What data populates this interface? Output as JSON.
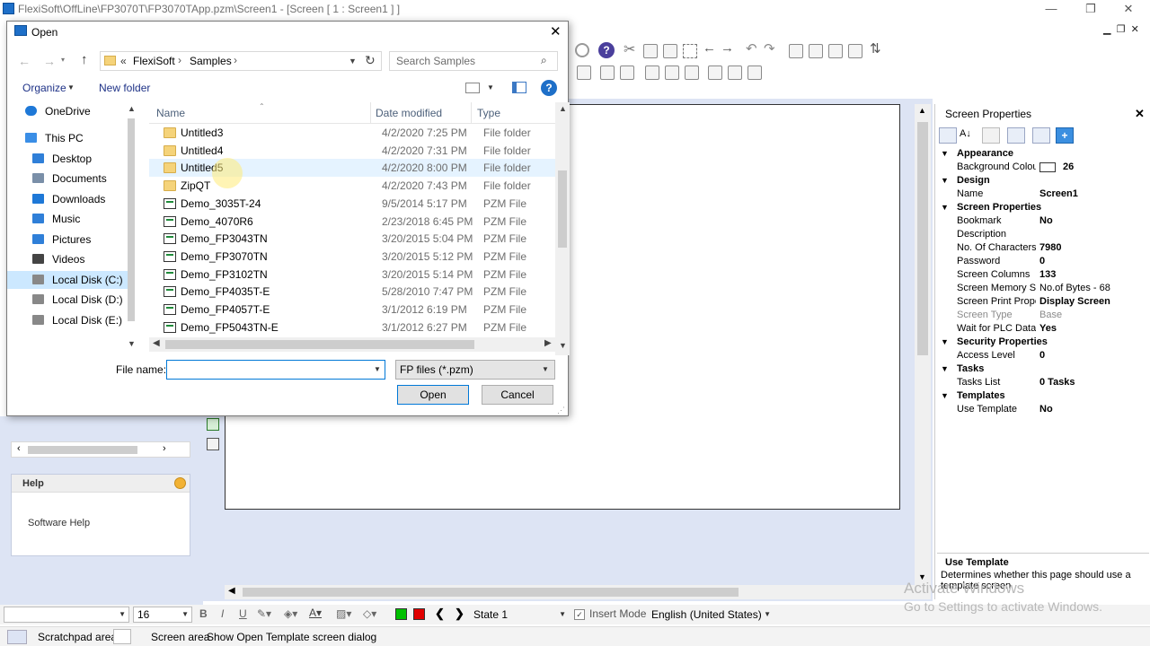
{
  "app": {
    "title": "FlexiSoft\\OffLine\\FP3070T\\FP3070TApp.pzm\\Screen1 - [Screen  [ 1 :  Screen1 ] ]",
    "minimize": "—",
    "restore": "❐",
    "close": "✕"
  },
  "dialog": {
    "title": "Open",
    "close": "✕",
    "address": {
      "prefix": "«",
      "parts": [
        "FlexiSoft",
        "Samples"
      ]
    },
    "search_placeholder": "Search Samples",
    "organize_label": "Organize",
    "new_folder_label": "New folder",
    "nav_items": [
      {
        "label": "OneDrive",
        "icon": "cloud-icon"
      },
      {
        "label": "This PC",
        "icon": "computer-icon"
      },
      {
        "label": "Desktop",
        "icon": "desktop-icon"
      },
      {
        "label": "Documents",
        "icon": "documents-icon"
      },
      {
        "label": "Downloads",
        "icon": "downloads-icon"
      },
      {
        "label": "Music",
        "icon": "music-icon"
      },
      {
        "label": "Pictures",
        "icon": "pictures-icon"
      },
      {
        "label": "Videos",
        "icon": "videos-icon"
      },
      {
        "label": "Local Disk (C:)",
        "icon": "drive-icon"
      },
      {
        "label": "Local Disk (D:)",
        "icon": "drive-icon"
      },
      {
        "label": "Local Disk (E:)",
        "icon": "drive-icon"
      }
    ],
    "columns": {
      "name": "Name",
      "date": "Date modified",
      "type": "Type"
    },
    "files": [
      {
        "name": "Untitled3",
        "date": "4/2/2020 7:25 PM",
        "type": "File folder",
        "kind": "folder"
      },
      {
        "name": "Untitled4",
        "date": "4/2/2020 7:31 PM",
        "type": "File folder",
        "kind": "folder"
      },
      {
        "name": "Untitled5",
        "date": "4/2/2020 8:00 PM",
        "type": "File folder",
        "kind": "folder"
      },
      {
        "name": "ZipQT",
        "date": "4/2/2020 7:43 PM",
        "type": "File folder",
        "kind": "folder"
      },
      {
        "name": "Demo_3035T-24",
        "date": "9/5/2014 5:17 PM",
        "type": "PZM File",
        "kind": "pzm"
      },
      {
        "name": "Demo_4070R6",
        "date": "2/23/2018 6:45 PM",
        "type": "PZM File",
        "kind": "pzm"
      },
      {
        "name": "Demo_FP3043TN",
        "date": "3/20/2015 5:04 PM",
        "type": "PZM File",
        "kind": "pzm"
      },
      {
        "name": "Demo_FP3070TN",
        "date": "3/20/2015 5:12 PM",
        "type": "PZM File",
        "kind": "pzm"
      },
      {
        "name": "Demo_FP3102TN",
        "date": "3/20/2015 5:14 PM",
        "type": "PZM File",
        "kind": "pzm"
      },
      {
        "name": "Demo_FP4035T-E",
        "date": "5/28/2010 7:47 PM",
        "type": "PZM File",
        "kind": "pzm"
      },
      {
        "name": "Demo_FP4057T-E",
        "date": "3/1/2012 6:19 PM",
        "type": "PZM File",
        "kind": "pzm"
      },
      {
        "name": "Demo_FP5043TN-E",
        "date": "3/1/2012 6:27 PM",
        "type": "PZM File",
        "kind": "pzm"
      }
    ],
    "file_name_label": "File name:",
    "file_name_value": "",
    "file_type": "FP files (*.pzm)",
    "open_label": "Open",
    "cancel_label": "Cancel"
  },
  "help_panel": {
    "title": "Help",
    "item": "Software Help"
  },
  "properties": {
    "title": "Screen Properties",
    "close": "✕",
    "rows": [
      {
        "cat": "Appearance"
      },
      {
        "name": "Background Colour",
        "value": "26",
        "swatch": true
      },
      {
        "cat": "Design"
      },
      {
        "name": "Name",
        "value": "Screen1"
      },
      {
        "cat": "Screen Properties"
      },
      {
        "name": "Bookmark",
        "value": "No"
      },
      {
        "name": "Description",
        "value": ""
      },
      {
        "name": "No. Of Characters",
        "value": "7980"
      },
      {
        "name": "Password",
        "value": "0"
      },
      {
        "name": "Screen Columns",
        "value": "133"
      },
      {
        "name": "Screen Memory Stats",
        "value": "No.of Bytes - 68",
        "normal": true
      },
      {
        "name": "Screen Print Properties",
        "value": "Display Screen"
      },
      {
        "name": "Screen Type",
        "value": "Base",
        "dim": true
      },
      {
        "name": "Wait for PLC Data",
        "value": "Yes"
      },
      {
        "cat": "Security Properties"
      },
      {
        "name": "Access Level",
        "value": "0"
      },
      {
        "cat": "Tasks"
      },
      {
        "name": "Tasks List",
        "value": "0 Tasks"
      },
      {
        "cat": "Templates"
      },
      {
        "name": "Use Template",
        "value": "No"
      }
    ],
    "desc_title": "Use Template",
    "desc_text": "Determines whether this page should use a template screen"
  },
  "format_bar": {
    "font_size": "16",
    "state": "State 1",
    "insert_mode": "Insert Mode",
    "language": "English (United States)",
    "colors": {
      "green": "#00c000",
      "red": "#e00000"
    }
  },
  "status_bar": {
    "scratchpad": "Scratchpad area",
    "screen_area": "Screen area",
    "message": "Show Open Template screen dialog"
  },
  "watermark": {
    "line1": "Activate Windows",
    "line2": "Go to Settings to activate Windows."
  }
}
